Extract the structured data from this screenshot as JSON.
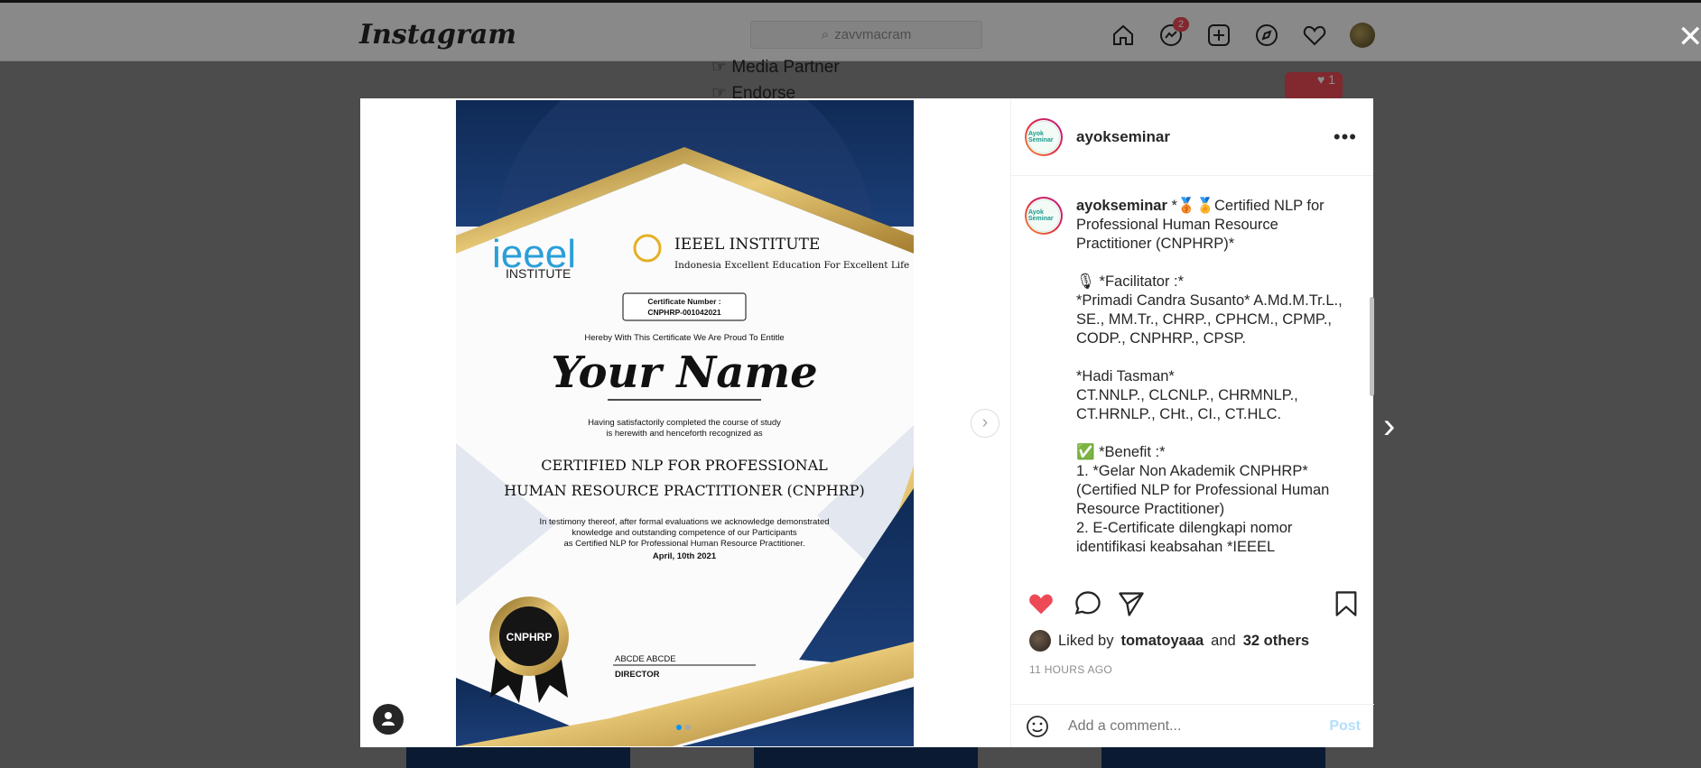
{
  "topbar": {
    "logo": "Instagram",
    "search_placeholder": "zavvmacram",
    "messages_badge": "2"
  },
  "background": {
    "menu_items": [
      "Media Partner",
      "Endorse"
    ],
    "activity_count": "1"
  },
  "post": {
    "username": "ayokseminar",
    "avatar_text": "Ayok Seminar",
    "caption_username": "ayokseminar",
    "caption_text": "*🥉🏅Certified NLP for Professional Human Resource Practitioner (CNPHRP)*\n\n🎙 *Facilitator :*\n*Primadi Candra Susanto* A.Md.M.Tr.L., SE., MM.Tr., CHRP., CPHCM., CPMP., CODP., CNPHRP., CPSP.\n\n*Hadi Tasman*\nCT.NNLP., CLCNLP., CHRMNLP., CT.HRNLP., CHt., CI., CT.HLC.\n\n✅ *Benefit :*\n1. *Gelar Non Akademik CNPHRP* (Certified NLP for Professional Human Resource Practitioner)\n2. E-Certificate dilengkapi nomor identifikasi keabsahan *IEEEL",
    "liked_by_prefix": "Liked by",
    "liked_by_user": "tomatoyaaa",
    "liked_by_and": "and",
    "liked_by_others": "32 others",
    "timestamp": "11 HOURS AGO",
    "comment_placeholder": "Add a comment...",
    "post_button": "Post",
    "liked": true,
    "carousel_total": 2,
    "carousel_active": 1
  },
  "certificate": {
    "brand_top": "ieeel",
    "brand_sub": "INSTITUTE",
    "inst_title": "IEEEL INSTITUTE",
    "inst_tagline": "Indonesia Excellent Education For Excellent Life",
    "cert_number_label": "Certificate Number :",
    "cert_number": "CNPHRP-001042021",
    "entitle": "Hereby With This Certificate We Are Proud To Entitle",
    "name": "Your Name",
    "completed_1": "Having satisfactorily completed the course of study",
    "completed_2": "is herewith and henceforth recognized as",
    "title_1": "CERTIFIED NLP FOR PROFESSIONAL",
    "title_2": "HUMAN RESOURCE PRACTITIONER (CNPHRP)",
    "body_1": "In testimony thereof, after formal evaluations we acknowledge demonstrated",
    "body_2": "knowledge and outstanding competence of our Participants",
    "body_3": "as Certified NLP for Professional Human Resource Practitioner.",
    "date": "April, 10th 2021",
    "seal": "CNPHRP",
    "signer": "ABCDE ABCDE",
    "signer_role": "DIRECTOR"
  },
  "colors": {
    "navy": "#13315e",
    "gold": "#c9a24a",
    "like_red": "#ed4956",
    "accent_blue": "#0095f6"
  }
}
